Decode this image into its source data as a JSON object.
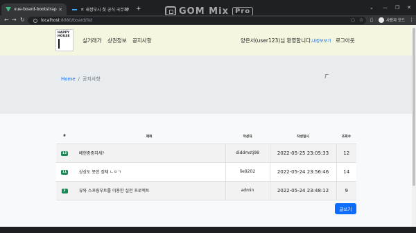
{
  "browser": {
    "tabs": [
      {
        "title": "vue-board-bootstrap",
        "active": true
      },
      {
        "title": "ㅍ 새정부시 첫 공식 국무회의",
        "active": false
      }
    ],
    "new_tab": "+",
    "address": {
      "host": "localhost",
      "port_path": ":8080/board/list"
    },
    "profile_name": "사용자 모드",
    "watermark": {
      "brand": "GOM Mix",
      "edition": "Pro"
    }
  },
  "navbar": {
    "logo_text": "HAPPY HOUSE",
    "links": [
      "실거래가",
      "상권정보",
      "공지사항"
    ],
    "welcome": "양은서(user123)님 환영합니다.",
    "mypage": "내정보보기",
    "logout": "로그아웃"
  },
  "breadcrumb": {
    "home": "Home",
    "separator": "/",
    "current": "공지사항"
  },
  "table": {
    "headers": [
      "#",
      "제목",
      "작성자",
      "작성일시",
      "조회수"
    ],
    "rows": [
      {
        "no": "13",
        "title": "배현중중지세?",
        "writer": "diddmstj98",
        "date": "2022-05-25 23:05:33",
        "hits": "12"
      },
      {
        "no": "11",
        "title": "상상도 못한 정체 ㄴㅇㄱ",
        "writer": "lie9202",
        "date": "2022-05-24 23:56:46",
        "hits": "14"
      },
      {
        "no": "3",
        "title": "뷰와 스프링부트를 이용한 실전 프로젝트",
        "writer": "admin",
        "date": "2022-05-24 23:48:12",
        "hits": "9"
      }
    ]
  },
  "write_button": "글쓰기",
  "colors": {
    "accent": "#0d6efd",
    "badge": "#198754",
    "navbar_bg": "#f4f6df",
    "hero_bg": "#e9ecef"
  }
}
